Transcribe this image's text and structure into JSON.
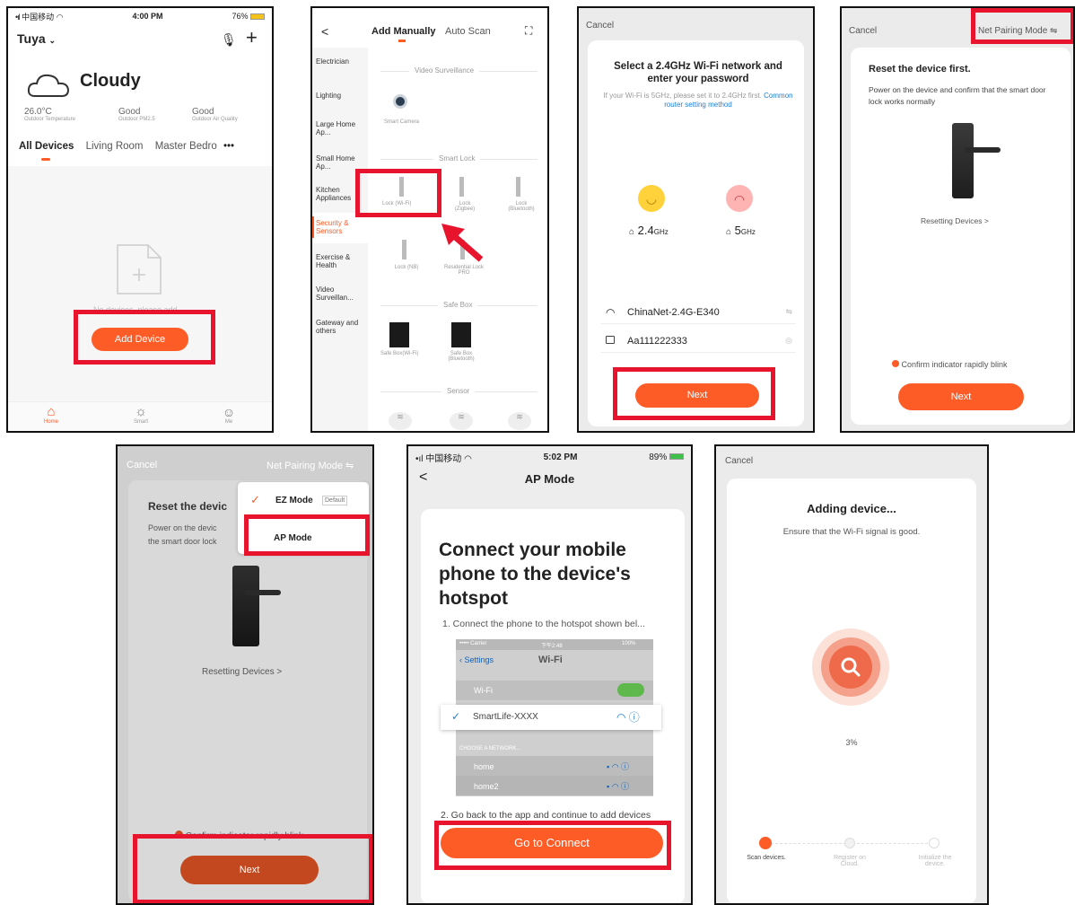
{
  "s1": {
    "carrier": "中国移动",
    "time": "4:00 PM",
    "battery": "76%",
    "home_name": "Tuya",
    "weather": "Cloudy",
    "stats": [
      {
        "value": "26.0°C",
        "label": "Outdoor Temperature"
      },
      {
        "value": "Good",
        "label": "Outdoor PM2.5"
      },
      {
        "value": "Good",
        "label": "Outdoor Air Quality"
      }
    ],
    "tabs": [
      "All Devices",
      "Living Room",
      "Master Bedro"
    ],
    "more": "•••",
    "no_devices": "No devices, please add",
    "add_button": "Add Device",
    "nav": [
      "Home",
      "Smart",
      "Me"
    ]
  },
  "s2": {
    "back": "<",
    "tab_manual": "Add Manually",
    "tab_scan": "Auto Scan",
    "categories": [
      "Electrician",
      "Lighting",
      "Large Home Ap...",
      "Small Home Ap...",
      "Kitchen Appliances",
      "Security & Sensors",
      "Exercise & Health",
      "Video Surveillan...",
      "Gateway and others"
    ],
    "sec_video": "Video Surveillance",
    "smart_camera": "Smart Camera",
    "sec_lock": "Smart Lock",
    "locks": [
      "Lock (Wi-Fi)",
      "Lock (Zigbee)",
      "Lock (Bluetooth)",
      "Lock (NB)",
      "Residential Lock PRO"
    ],
    "sec_safe": "Safe Box",
    "safes": [
      "Safe Box(Wi-Fi)",
      "Safe Box (Bluetooth)"
    ],
    "sec_sensor": "Sensor"
  },
  "s3": {
    "cancel": "Cancel",
    "title": "Select a 2.4GHz Wi-Fi network and enter your password",
    "hint": "If your Wi-Fi is 5GHz, please set it to 2.4GHz first.",
    "link": "Common router setting method",
    "band_good": "2.4",
    "band_bad": "5",
    "unit": "GHz",
    "ssid": "ChinaNet-2.4G-E340",
    "password": "Aa111222333",
    "next": "Next"
  },
  "s4": {
    "cancel": "Cancel",
    "mode": "Net Pairing Mode ⇋",
    "title": "Reset the device first.",
    "desc": "Power on the device and confirm that the smart door lock works normally",
    "resetting": "Resetting Devices >",
    "confirm": "Confirm indicator rapidly blink",
    "next": "Next"
  },
  "s5": {
    "cancel": "Cancel",
    "mode": "Net Pairing Mode ⇋",
    "title": "Reset the devic",
    "desc1": "Power on the devic",
    "desc2": "the smart door lock",
    "ez": "EZ Mode",
    "default": "Default",
    "ap": "AP Mode",
    "resetting": "Resetting Devices >",
    "confirm": "Confirm indicator rapidly blink",
    "next": "Next"
  },
  "s6": {
    "carrier": "中国移动",
    "time": "5:02 PM",
    "battery": "89%",
    "title": "AP Mode",
    "heading": "Connect your mobile phone to the device's hotspot",
    "step1": "1. Connect the phone to the hotspot shown bel...",
    "inner": {
      "carrier": "••••• Carrier",
      "time": "下午2:48",
      "battery": "100%",
      "settings": "Settings",
      "wifi_title": "Wi-Fi",
      "wifi_label": "Wi-Fi",
      "smartlife": "SmartLife-XXXX",
      "choose": "CHOOSE A NETWORK...",
      "networks": [
        "home",
        "home2"
      ]
    },
    "step2": "2. Go back to the app and continue to add devices",
    "connect": "Go to Connect"
  },
  "s7": {
    "cancel": "Cancel",
    "title": "Adding device...",
    "subtitle": "Ensure that the Wi-Fi signal is good.",
    "percent": "3%",
    "progress": 0.03,
    "steps": [
      "Scan devices.",
      "Register on Cloud.",
      "Initialize the device."
    ]
  }
}
